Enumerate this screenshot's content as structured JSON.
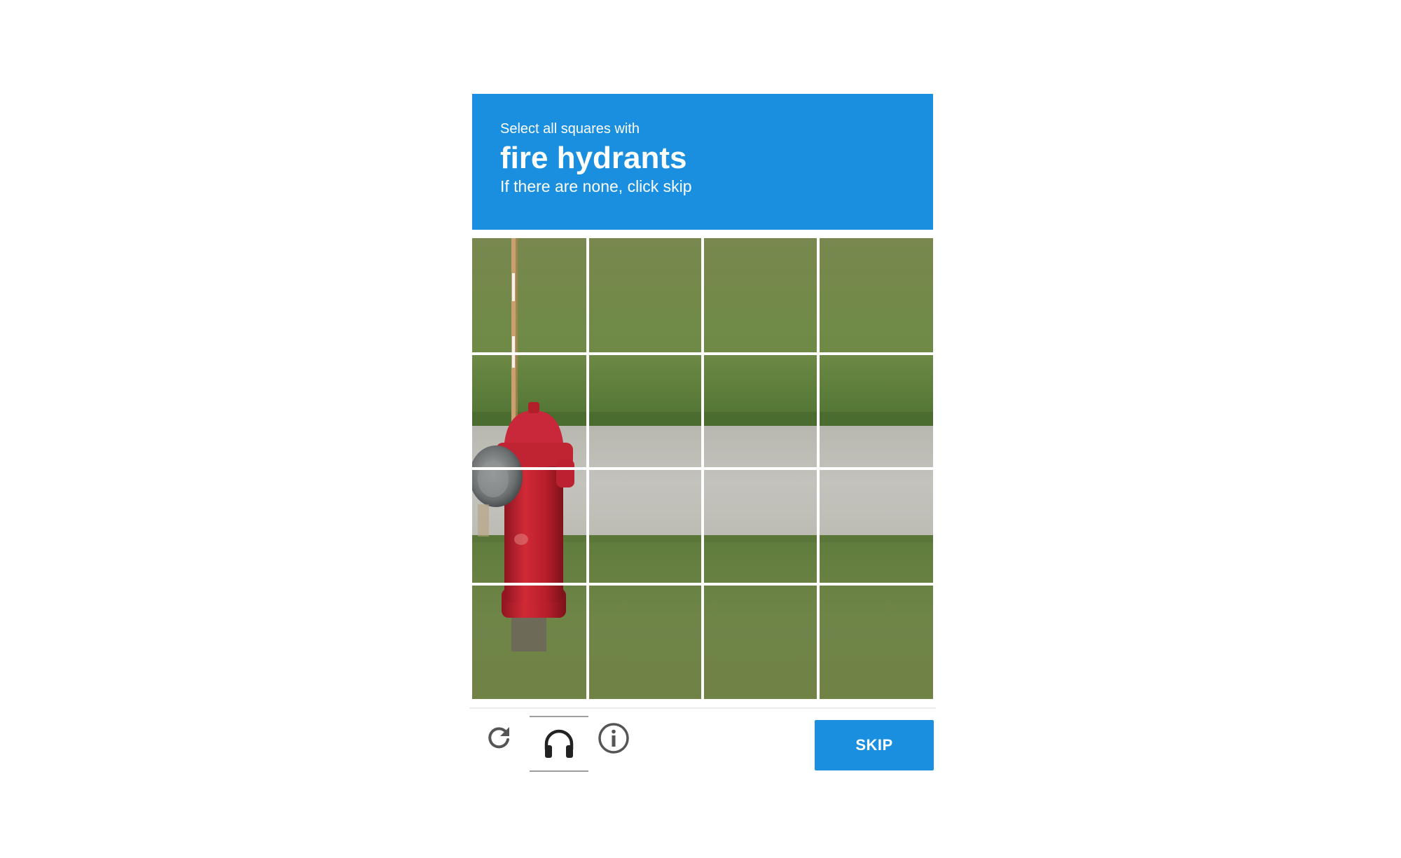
{
  "challenge": {
    "instruction": "Select all squares with",
    "keyword": "fire hydrants",
    "hint": "If there are none, click skip"
  },
  "grid": {
    "rows": 4,
    "columns": 4
  },
  "footer": {
    "reload_icon": "reload-icon",
    "audio_icon": "headphones-icon",
    "info_icon": "info-icon",
    "skip_label": "SKIP"
  },
  "colors": {
    "accent": "#1a8fe0",
    "grass": "#6c8048",
    "road": "#bebdb7",
    "hydrant": "#c4222f"
  }
}
